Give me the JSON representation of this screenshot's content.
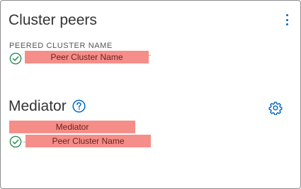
{
  "cluster_peers": {
    "title": "Cluster peers",
    "column_header": "PEERED CLUSTER NAME",
    "peer_name": "Peer Cluster Name",
    "status_icon": "check-circle-icon",
    "menu_icon": "kebab-menu-icon"
  },
  "mediator": {
    "title": "Mediator",
    "mediator_name": "Mediator",
    "peer_name": "Peer Cluster Name",
    "status_icon": "check-circle-icon",
    "help_icon": "help-circle-icon",
    "settings_icon": "gear-icon"
  },
  "colors": {
    "accent": "#0067c5",
    "success": "#2e8b57",
    "redaction": "#f58e88",
    "border": "#8c8c8c"
  }
}
